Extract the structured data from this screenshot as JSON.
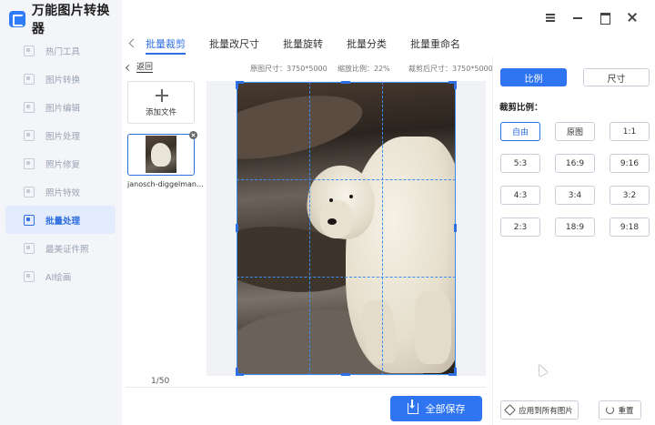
{
  "app": {
    "title": "万能图片转换器"
  },
  "sidebar": {
    "items": [
      {
        "label": "热门工具"
      },
      {
        "label": "图片转换"
      },
      {
        "label": "图片编辑"
      },
      {
        "label": "图片处理"
      },
      {
        "label": "照片修复"
      },
      {
        "label": "照片特效"
      },
      {
        "label": "批量处理"
      },
      {
        "label": "最美证件照"
      },
      {
        "label": "AI绘画"
      }
    ],
    "active_index": 6
  },
  "tabs": [
    {
      "label": "批量裁剪"
    },
    {
      "label": "批量改尺寸"
    },
    {
      "label": "批量旋转"
    },
    {
      "label": "批量分类"
    },
    {
      "label": "批量重命名"
    }
  ],
  "toolbar": {
    "back_label": "返回",
    "original_size": "原图尺寸：3750*5000",
    "zoom": "缩放比例：22%",
    "cropped_size": "裁剪后尺寸：3750*5000"
  },
  "files": {
    "add_label": "添加文件",
    "items": [
      {
        "name": "janosch-diggelman..."
      }
    ],
    "pager": "1/50"
  },
  "actions": {
    "save_all": "全部保存"
  },
  "panel": {
    "mode_ratio": "比例",
    "mode_size": "尺寸",
    "ratio_title": "裁剪比例：",
    "ratios": [
      "自由",
      "原图",
      "1:1",
      "5:3",
      "16:9",
      "9:16",
      "4:3",
      "3:4",
      "3:2",
      "2:3",
      "18:9",
      "9:18"
    ],
    "selected_ratio": "自由",
    "apply_all": "应用到所有图片",
    "reset": "重置"
  },
  "colors": {
    "accent": "#2f74f0",
    "sidebar_bg": "#f3f5f9",
    "active_nav_bg": "#e2ecfc"
  },
  "icons": [
    "app-logo-icon",
    "menu-icon",
    "minimize-icon",
    "maximize-icon",
    "close-icon",
    "plus-icon",
    "download-icon",
    "cube-icon",
    "refresh-icon"
  ]
}
